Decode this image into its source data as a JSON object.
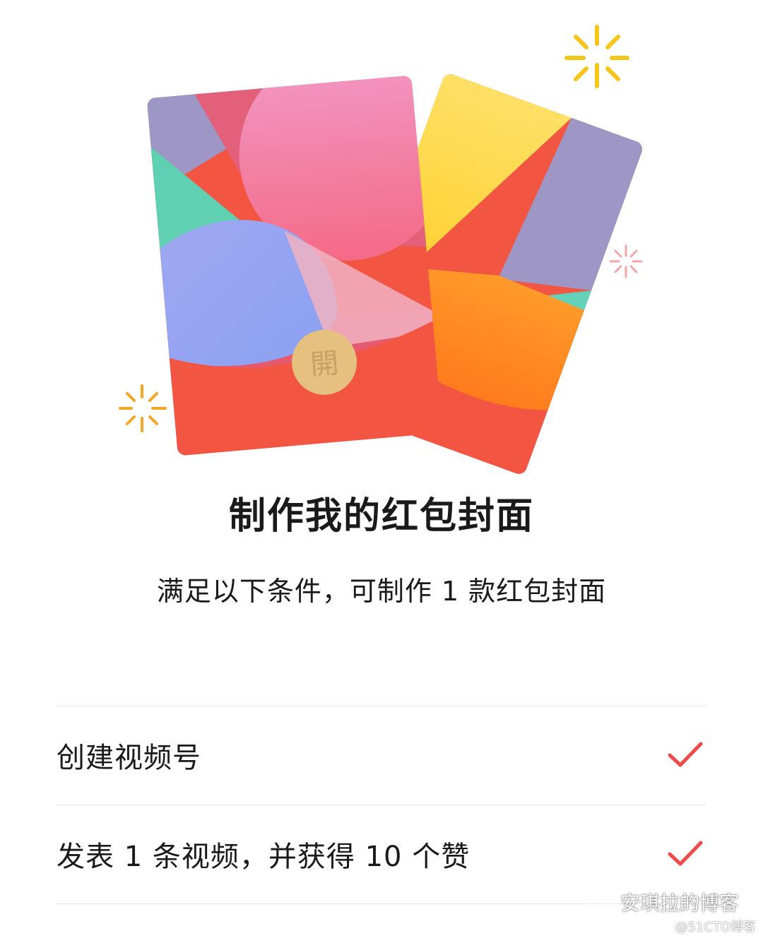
{
  "illustration": {
    "open_glyph": "開"
  },
  "title": "制作我的红包封面",
  "subtitle": "满足以下条件，可制作 1 款红包封面",
  "requirements": [
    {
      "label": "创建视频号",
      "status": "completed",
      "icon": "check-icon"
    },
    {
      "label": "发表 1 条视频，并获得 10 个赞",
      "status": "completed",
      "icon": "check-icon"
    }
  ],
  "watermark": {
    "name": "安琪拉的博客",
    "site": "@51CTO博客",
    "icon": "wechat-icon"
  },
  "colors": {
    "accent_red": "#f04a4a",
    "sparkle_yellow": "#f5c518",
    "sparkle_orange": "#f5a623",
    "sparkle_pink": "#f4a6a6",
    "envelope_base": "#f25542"
  }
}
